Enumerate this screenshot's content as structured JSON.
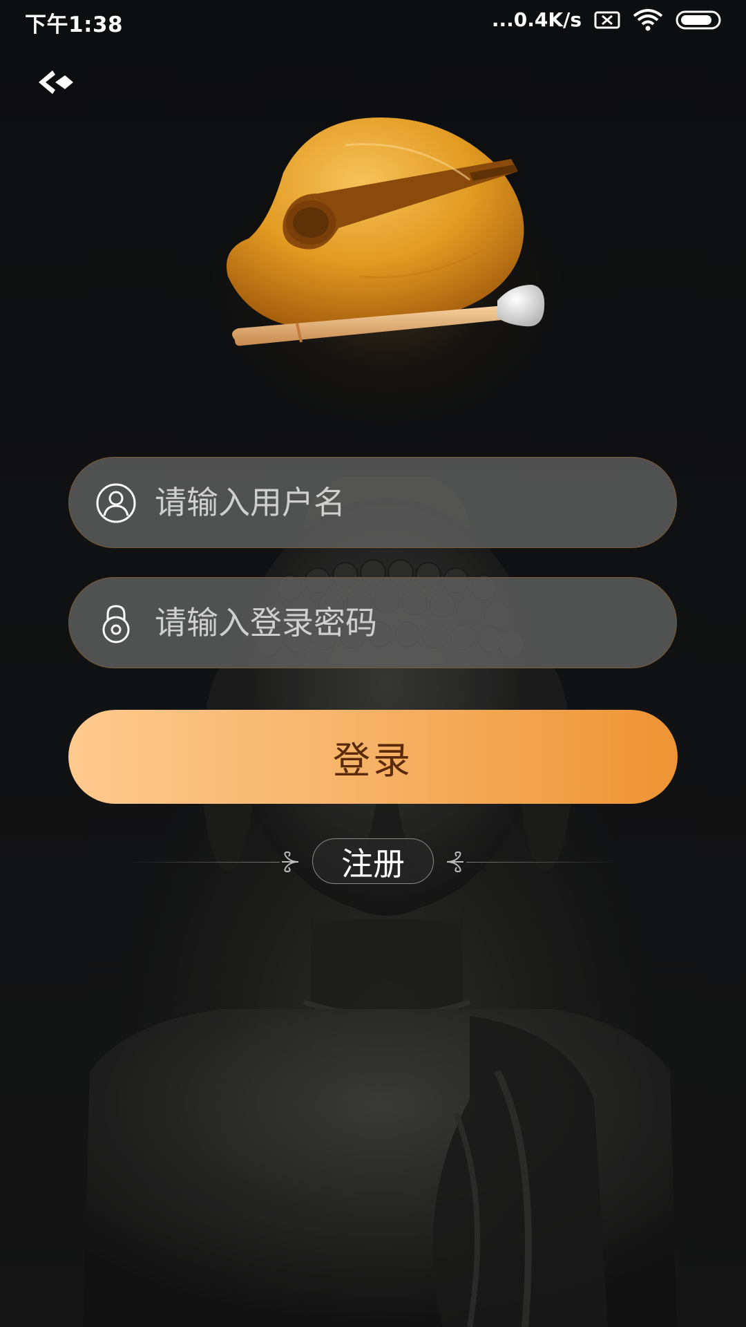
{
  "status_bar": {
    "time": "下午1:38",
    "network_speed": "...0.4K/s",
    "icons": [
      "sim-off-icon",
      "wifi-icon",
      "battery-icon"
    ]
  },
  "nav": {
    "back_icon": "back-arrow-icon"
  },
  "logo": {
    "icon": "wooden-fish-icon"
  },
  "form": {
    "username": {
      "icon": "user-icon",
      "placeholder": "请输入用户名",
      "value": ""
    },
    "password": {
      "icon": "lock-icon",
      "placeholder": "请输入登录密码",
      "value": ""
    },
    "login_label": "登录",
    "register_label": "注册"
  },
  "colors": {
    "login_gradient_start": "#fdca8e",
    "login_gradient_end": "#ee9433",
    "login_text": "#5a2a0b",
    "field_background": "#5f5f5f",
    "field_border": "#7a5a33",
    "page_background": "#0c0d0e"
  }
}
